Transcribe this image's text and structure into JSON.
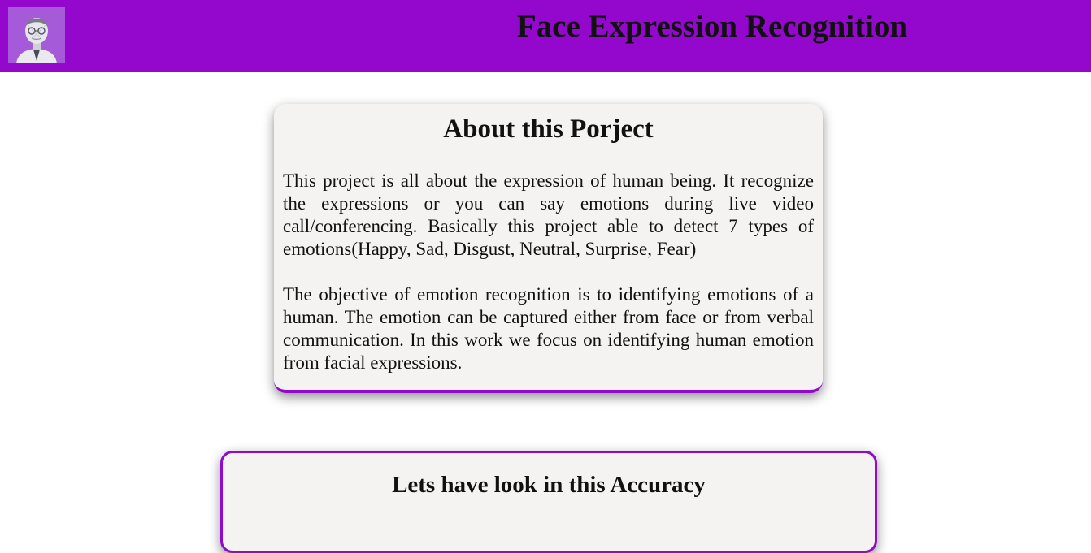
{
  "header": {
    "title": "Face Expression Recognition",
    "logo_icon": "face-avatar-icon",
    "background": "#9308cc"
  },
  "about": {
    "heading": "About this Porject",
    "paragraph_1": "This project is all about the expression of human being. It recognize the expressions or you can say emotions during live video call/conferencing. Basically this project able to detect 7 types of emotions(Happy, Sad, Disgust, Neutral, Surprise, Fear)",
    "paragraph_2": "The objective of emotion recognition is to identifying emotions of a human. The emotion can be captured either from face or from verbal communication. In this work we focus on identifying human emotion from facial expressions."
  },
  "accuracy": {
    "heading": "Lets have look in this Accuracy"
  },
  "colors": {
    "accent": "#9308cc",
    "card_background": "#f4f3f1"
  }
}
